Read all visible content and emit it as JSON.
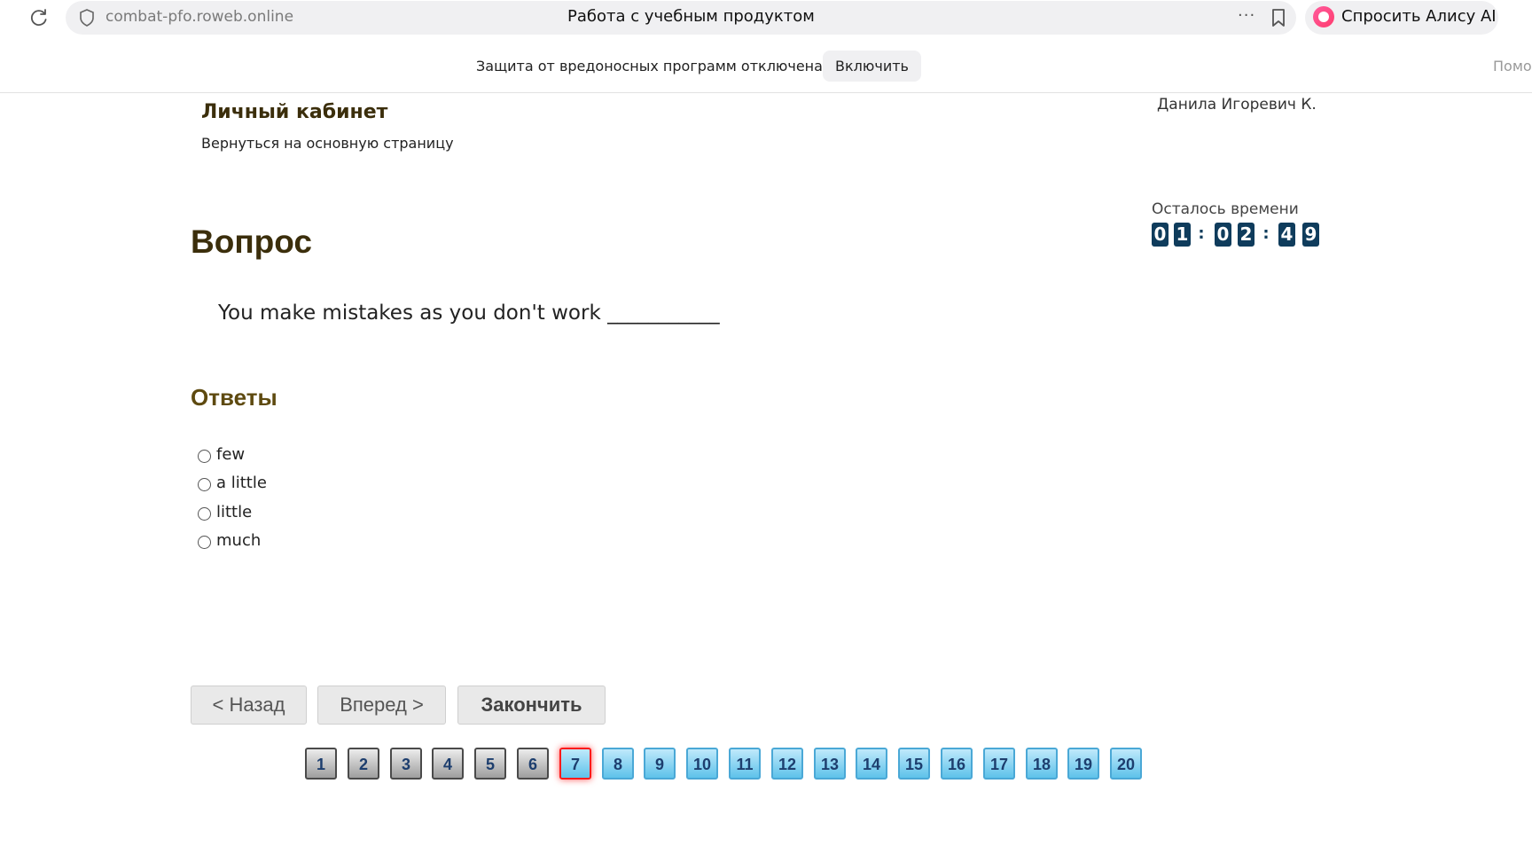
{
  "browser": {
    "url": "combat-pfo.roweb.online",
    "tab_title": "Работа с учебным продуктом",
    "more_icon": "···",
    "alice_label": "Спросить Алису AI"
  },
  "infobar": {
    "message": "Защита от вредоносных программ отключена",
    "enable_label": "Включить",
    "help_label": "Помо"
  },
  "header": {
    "title": "Личный кабинет",
    "back_link": "Вернуться на основную страницу",
    "user": "Данила Игоревич К."
  },
  "timer": {
    "label": "Осталось времени",
    "digits": [
      "0",
      "1",
      "0",
      "2",
      "4",
      "9"
    ],
    "separator": ":"
  },
  "question": {
    "heading": "Вопрос",
    "text": "You make mistakes as you don't work ___________"
  },
  "answers": {
    "heading": "Ответы",
    "options": [
      "few",
      "a little",
      "little",
      "much"
    ]
  },
  "navigation": {
    "back_label": "< Назад",
    "forward_label": "Вперед >",
    "finish_label": "Закончить"
  },
  "pager": {
    "pages": [
      "1",
      "2",
      "3",
      "4",
      "5",
      "6",
      "7",
      "8",
      "9",
      "10",
      "11",
      "12",
      "13",
      "14",
      "15",
      "16",
      "17",
      "18",
      "19",
      "20"
    ],
    "answered_count": 6,
    "current_page": "7"
  }
}
